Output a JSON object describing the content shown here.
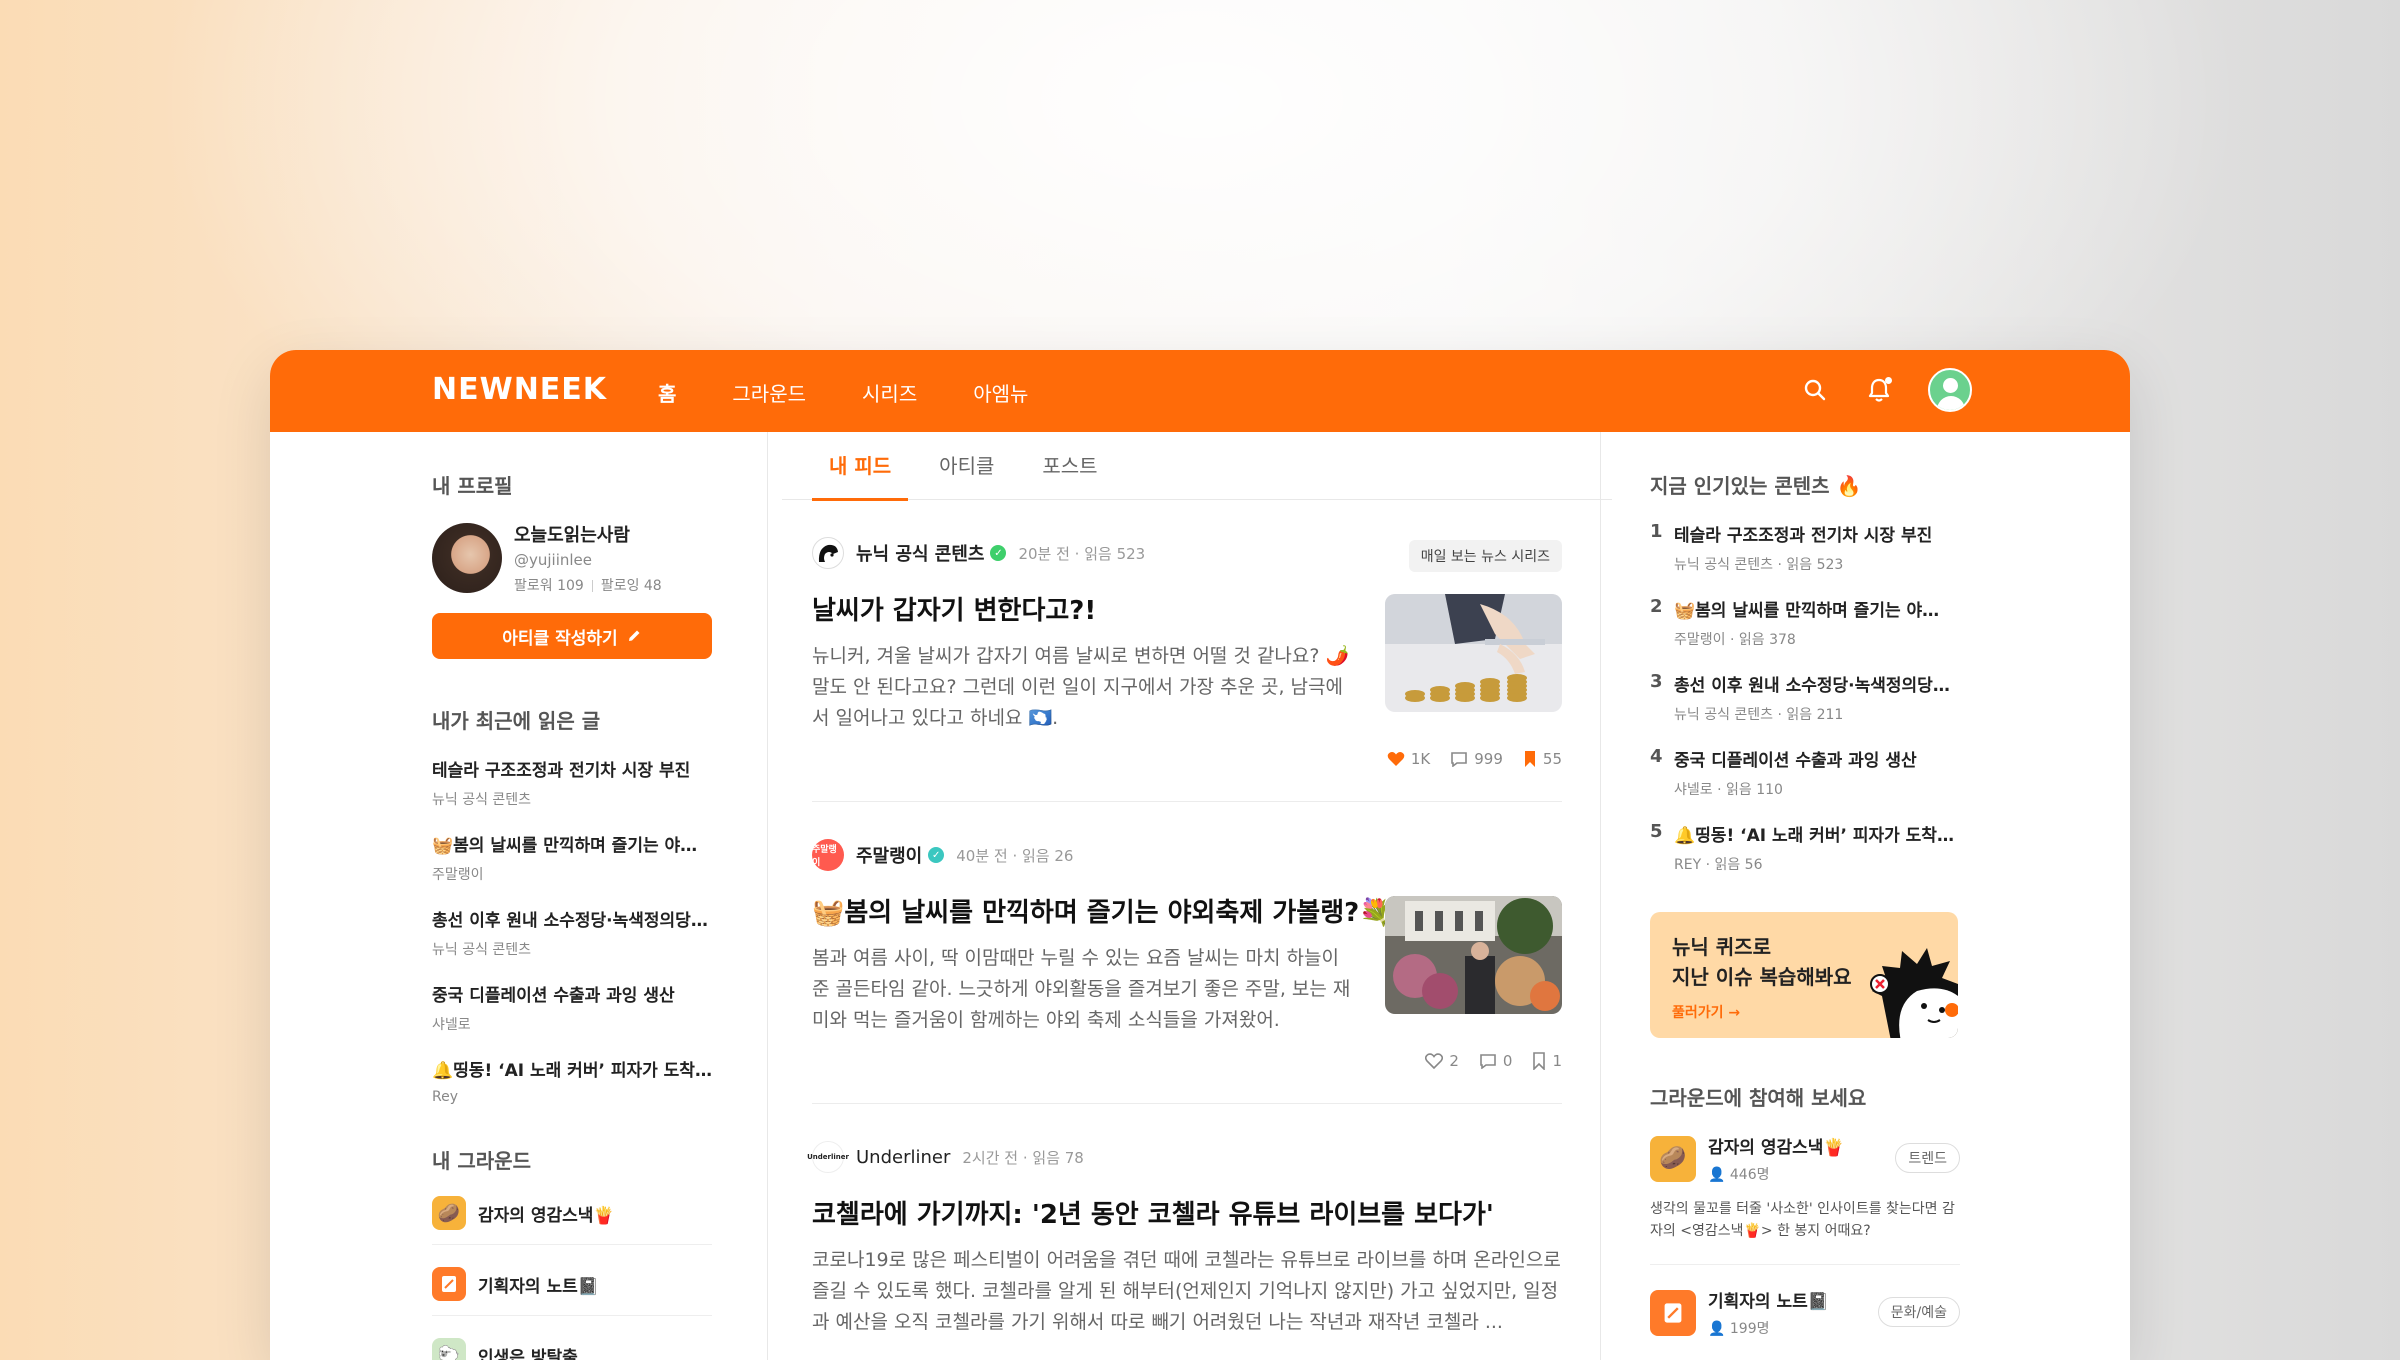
{
  "nav": {
    "logo": "NEWNEEK",
    "items": [
      "홈",
      "그라운드",
      "시리즈",
      "아엠뉴"
    ]
  },
  "profile": {
    "section_title": "내 프로필",
    "name": "오늘도읽는사람",
    "handle": "@yujiinlee",
    "followers": "팔로워 109",
    "following": "팔로잉 48",
    "write_button": "아티클 작성하기"
  },
  "recent": {
    "title": "내가 최근에 읽은 글",
    "items": [
      {
        "title": "테슬라 구조조정과 전기차 시장 부진",
        "source": "뉴닉 공식 콘텐츠"
      },
      {
        "title": "🧺봄의 날씨를 만끽하며 즐기는 야외...",
        "source": "주말랭이"
      },
      {
        "title": "총선 이후 원내 소수정당·녹색정의당 ...",
        "source": "뉴닉 공식 콘텐츠"
      },
      {
        "title": "중국 디플레이션 수출과 과잉 생산",
        "source": "샤넬로"
      },
      {
        "title": "🔔띵동! ‘AI 노래 커버’ 피자가 도착...",
        "source": "Rey"
      }
    ]
  },
  "my_ground": {
    "title": "내 그라운드",
    "items": [
      {
        "name": "감자의 영감스낵🍟",
        "icon": "snack-box-icon"
      },
      {
        "name": "기획자의 노트📓",
        "icon": "note-icon"
      },
      {
        "name": "인생은 방탈출",
        "icon": "escape-icon"
      }
    ]
  },
  "tabs": [
    "내 피드",
    "아티클",
    "포스트"
  ],
  "feed": [
    {
      "source": "뉴닉 공식 콘텐츠",
      "meta": "20분 전 · 읽음 523",
      "badge": "매일 보는 뉴스 시리즈",
      "title": "날씨가 갑자기 변한다고?!",
      "body": "뉴니커, 겨울 날씨가 갑자기 여름 날씨로 변하면 어떨 것 같나요? 🌶️ 말도 안 된다고요? 그런데 이런 일이 지구에서 가장 추운 곳, 남극에서 일어나고 있다고 하네요 🇦🇶.",
      "likes": "1K",
      "comments": "999",
      "bookmarks": "55"
    },
    {
      "source": "주말랭이",
      "meta": "40분 전 · 읽음 26",
      "title": "🧺봄의 날씨를 만끽하며 즐기는 야외축제 가볼랭?💐",
      "body": "봄과 여름 사이, 딱 이맘때만 누릴 수 있는 요즘 날씨는 마치 하늘이 준 골든타임 같아. 느긋하게 야외활동을 즐겨보기 좋은 주말, 보는 재미와 먹는 즐거움이 함께하는 야외 축제 소식들을 가져왔어.",
      "likes": "2",
      "comments": "0",
      "bookmarks": "1"
    },
    {
      "source": "Underliner",
      "meta": "2시간 전 · 읽음 78",
      "title": "코첼라에 가기까지: '2년 동안 코첼라 유튜브 라이브를 보다가'",
      "body": "코로나19로 많은 페스티벌이 어려움을 겪던 때에 코첼라는 유튜브로 라이브를 하며 온라인으로 즐길 수 있도록 했다. 코첼라를 알게 된 해부터(언제인지 기억나지 않지만) 가고 싶었지만, 일정과 예산을 오직 코첼라를 가기 위해서 따로 빼기 어려웠던 나는 작년과 재작년 코첼라 ..."
    }
  ],
  "hot": {
    "title": "지금 인기있는 콘텐츠 🔥",
    "items": [
      {
        "num": "1",
        "title": "테슬라 구조조정과 전기차 시장 부진",
        "meta": "뉴닉 공식 콘텐츠 · 읽음 523"
      },
      {
        "num": "2",
        "title": "🧺봄의 날씨를 만끽하며 즐기는 야외...",
        "meta": "주말랭이 · 읽음 378"
      },
      {
        "num": "3",
        "title": "총선 이후 원내 소수정당·녹색정의당 ...",
        "meta": "뉴닉 공식 콘텐츠 · 읽음 211"
      },
      {
        "num": "4",
        "title": "중국 디플레이션 수출과 과잉 생산",
        "meta": "샤넬로 · 읽음 110"
      },
      {
        "num": "5",
        "title": "🔔띵동! ‘AI 노래 커버’ 피자가 도착했...",
        "meta": "REY · 읽음 56"
      }
    ]
  },
  "quiz": {
    "line1": "뉴닉 퀴즈로",
    "line2": "지난 이슈 복습해봐요",
    "link": "풀러가기 →"
  },
  "ground_join": {
    "title": "그라운드에 참여해 보세요",
    "items": [
      {
        "name": "감자의 영감스낵🍟",
        "count": "446명",
        "tag": "트렌드",
        "desc": "생각의 물꼬를 터줄 '사소한' 인사이트를 찾는다면 감자의 <영감스낵🍟> 한 봉지 어때요?"
      },
      {
        "name": "기획자의 노트📓",
        "count": "199명",
        "tag": "문화/예술",
        "desc": ""
      }
    ]
  },
  "colors": {
    "brand": "#ff6b09",
    "verified_green": "#3ecf6b",
    "verified_teal": "#3bc7c0"
  }
}
